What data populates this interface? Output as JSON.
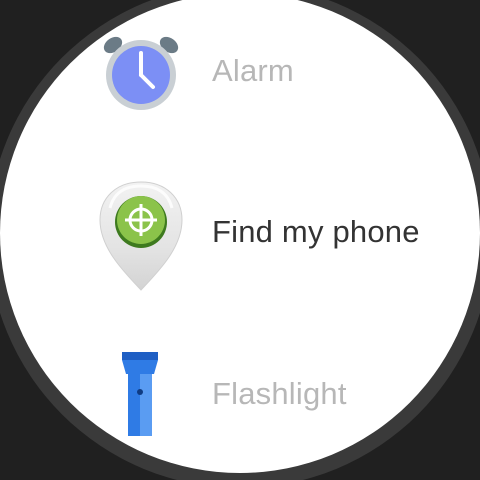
{
  "menu": {
    "items": [
      {
        "label": "Alarm",
        "icon": "alarm-clock-icon",
        "state": "dimmed"
      },
      {
        "label": "Find my phone",
        "icon": "find-my-phone-icon",
        "state": "selected"
      },
      {
        "label": "Flashlight",
        "icon": "flashlight-icon",
        "state": "dimmed"
      }
    ]
  },
  "colors": {
    "background": "#202020",
    "bezel": "#3a3a3a",
    "face": "#ffffff",
    "dim_text": "#b7b7b7",
    "active_text": "#333333",
    "alarm_blue": "#7c8ff5",
    "find_green": "#8bc34a",
    "flash_blue": "#2f7be5"
  }
}
